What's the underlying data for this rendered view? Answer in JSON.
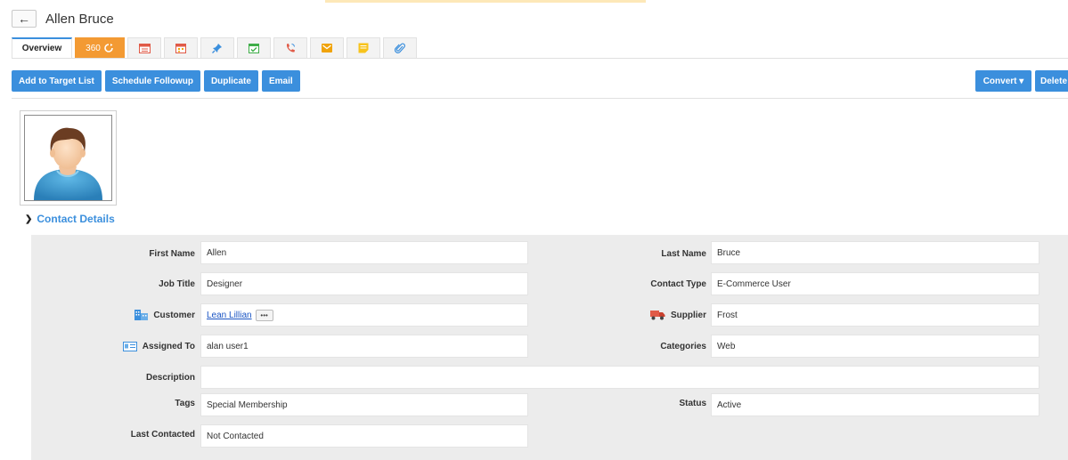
{
  "header": {
    "title": "Allen Bruce",
    "back_icon": "back-arrow-icon"
  },
  "tabs": [
    {
      "label": "Overview",
      "active": true
    },
    {
      "label": "360",
      "accent": "#f39a33"
    },
    {
      "icon": "list-icon",
      "color": "#e05a47"
    },
    {
      "icon": "calendar-icon",
      "color": "#e05a47"
    },
    {
      "icon": "pin-icon",
      "color": "#3b8fdd"
    },
    {
      "icon": "task-icon",
      "color": "#3fae49"
    },
    {
      "icon": "phone-icon",
      "color": "#e05a47"
    },
    {
      "icon": "mail-icon",
      "color": "#f0a30a"
    },
    {
      "icon": "note-icon",
      "color": "#f0a30a"
    },
    {
      "icon": "paperclip-icon",
      "color": "#3b8fdd"
    }
  ],
  "toolbar": {
    "add_to_target_list": "Add to Target List",
    "schedule_followup": "Schedule Followup",
    "duplicate": "Duplicate",
    "email": "Email",
    "convert": "Convert ▾",
    "delete": "Delete"
  },
  "section": {
    "title": "Contact Details"
  },
  "fields": {
    "first_name": {
      "label": "First Name",
      "value": "Allen"
    },
    "last_name": {
      "label": "Last Name",
      "value": "Bruce"
    },
    "job_title": {
      "label": "Job Title",
      "value": "Designer"
    },
    "contact_type": {
      "label": "Contact Type",
      "value": "E-Commerce User"
    },
    "customer": {
      "label": "Customer",
      "value": "Lean Lillian",
      "more": "•••"
    },
    "supplier": {
      "label": "Supplier",
      "value": "Frost"
    },
    "assigned_to": {
      "label": "Assigned To",
      "value": "alan user1"
    },
    "categories": {
      "label": "Categories",
      "value": "Web"
    },
    "description": {
      "label": "Description",
      "value": ""
    },
    "tags": {
      "label": "Tags",
      "value": "Special Membership"
    },
    "status": {
      "label": "Status",
      "value": "Active"
    },
    "last_contacted": {
      "label": "Last Contacted",
      "value": "Not Contacted"
    }
  },
  "colors": {
    "primary": "#3b8fdd",
    "accent_orange": "#f39a33",
    "panel": "#ececec"
  }
}
